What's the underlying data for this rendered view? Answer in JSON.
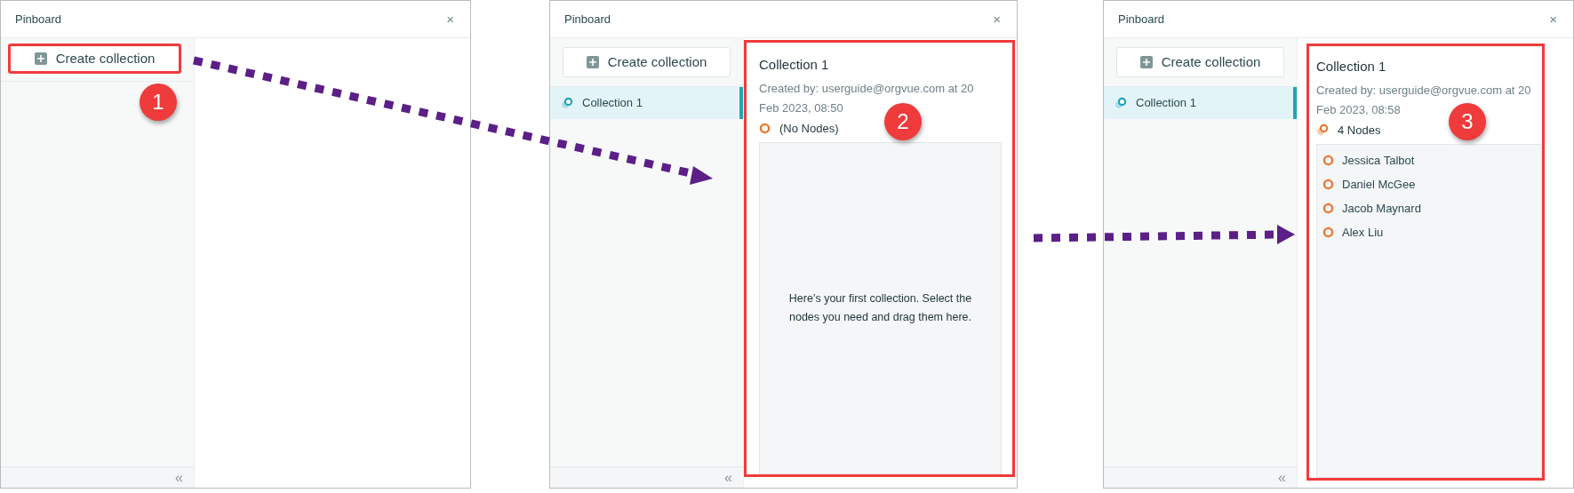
{
  "panels": [
    {
      "window_title": "Pinboard",
      "close": "×",
      "create_button": {
        "label": "Create collection",
        "highlighted": true
      },
      "callout": "1",
      "collapse": "«"
    },
    {
      "window_title": "Pinboard",
      "close": "×",
      "create_button": {
        "label": "Create collection",
        "highlighted": false
      },
      "callout": "2",
      "collections": [
        {
          "name": "Collection 1",
          "selected": true
        }
      ],
      "detail": {
        "highlighted": true,
        "title": "Collection 1",
        "created": "Created by: userguide@orgvue.com at 20 Feb 2023, 08:50",
        "count": {
          "kind": "empty",
          "label": "(No Nodes)"
        },
        "empty_message": "Here’s your first collection. Select the nodes you need and drag them here."
      },
      "collapse": "«"
    },
    {
      "window_title": "Pinboard",
      "close": "×",
      "create_button": {
        "label": "Create collection",
        "highlighted": false
      },
      "callout": "3",
      "collections": [
        {
          "name": "Collection 1",
          "selected": true
        }
      ],
      "detail": {
        "highlighted": true,
        "title": "Collection 1",
        "created": "Created by: userguide@orgvue.com at 20 Feb 2023, 08:58",
        "count": {
          "kind": "multiple",
          "label": "4 Nodes"
        },
        "nodes": [
          "Jessica Talbot",
          "Daniel McGee",
          "Jacob Maynard",
          "Alex Liu"
        ]
      },
      "collapse": "«"
    }
  ]
}
